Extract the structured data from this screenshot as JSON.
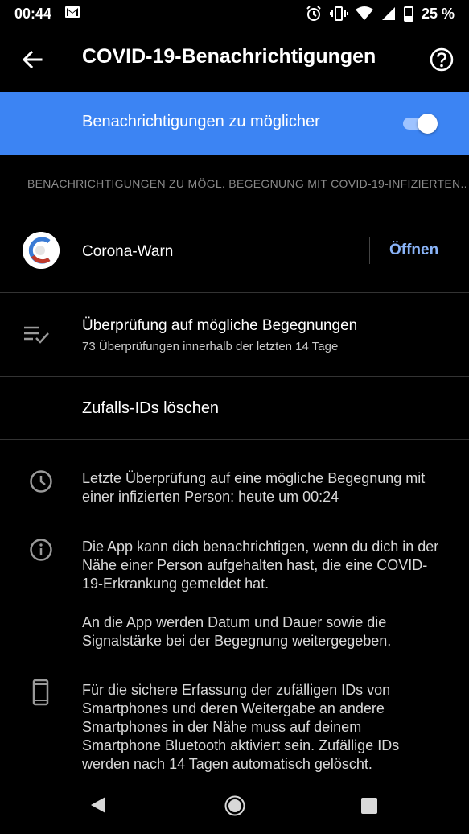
{
  "status_bar": {
    "time": "00:44",
    "battery": "25 %"
  },
  "app_bar": {
    "title": "COVID-19-Benachrichtigungen"
  },
  "banner": {
    "label": "Benachrichtigungen zu möglicher",
    "toggle_on": true,
    "color": "#3c84f3"
  },
  "section_header": "BENACHRICHTIGUNGEN ZU MÖGL. BEGEGNUNG MIT COVID-19-INFIZIERTEN...",
  "app_row": {
    "name": "Corona-Warn",
    "open_label": "Öffnen"
  },
  "exposure_check": {
    "title": "Überprüfung auf mögliche Begegnungen",
    "subtitle": "73 Überprüfungen innerhalb der letzten 14 Tage"
  },
  "delete_ids": {
    "label": "Zufalls-IDs löschen"
  },
  "info": {
    "last_check": "Letzte Überprüfung auf eine mögliche Begegnung mit einer infizierten Person: heute um 00:24",
    "about_p1": "Die App kann dich benachrichtigen, wenn du dich in der Nähe einer Person aufgehalten hast, die eine COVID-19-Erkrankung gemeldet hat.",
    "about_p2": "An die App werden Datum und Dauer sowie die Signalstärke bei der Begegnung weitergegeben.",
    "bluetooth": "Für die sichere Erfassung der zufälligen IDs von Smartphones und deren Weitergabe an andere Smartphones in der Nähe muss auf deinem Smartphone Bluetooth aktiviert sein. Zufällige IDs werden nach 14 Tagen automatisch gelöscht."
  },
  "icons": {
    "status_left": [
      "gmail-icon"
    ],
    "status_right": [
      "alarm-icon",
      "vibrate-icon",
      "wifi-icon",
      "signal-icon",
      "battery-icon"
    ]
  }
}
